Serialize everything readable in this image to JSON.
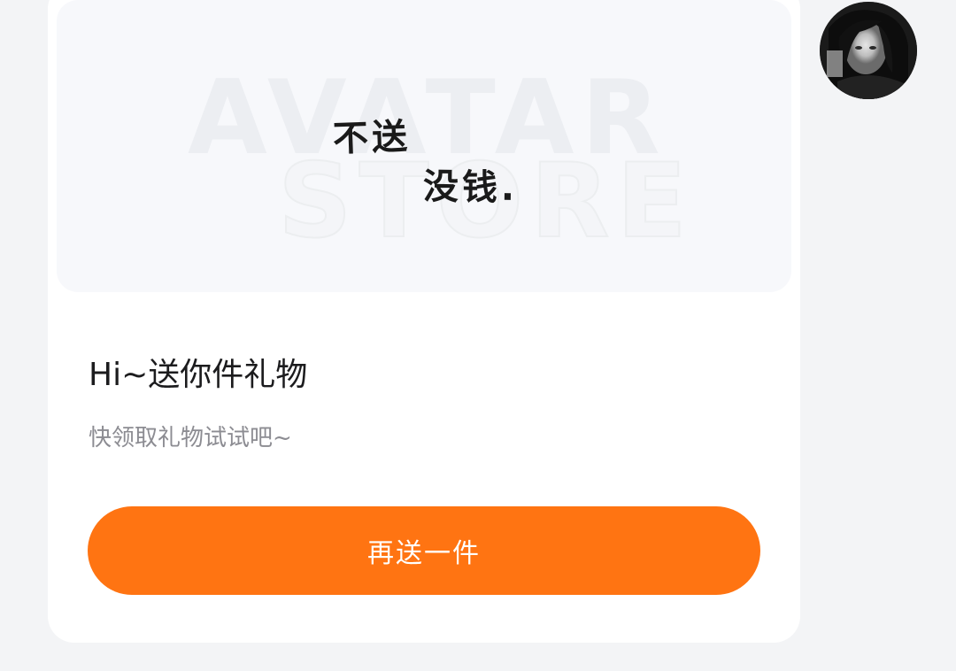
{
  "gift_card": {
    "image": {
      "watermark_line1": "AVATAR",
      "watermark_line2": "STORE",
      "handwritten_line1": "不送",
      "handwritten_line2": "没钱."
    },
    "title": "Hi~送你件礼物",
    "subtitle": "快领取礼物试试吧~",
    "send_again_label": "再送一件"
  },
  "colors": {
    "accent": "#ff7412",
    "background": "#f3f4f6",
    "card": "#ffffff"
  }
}
